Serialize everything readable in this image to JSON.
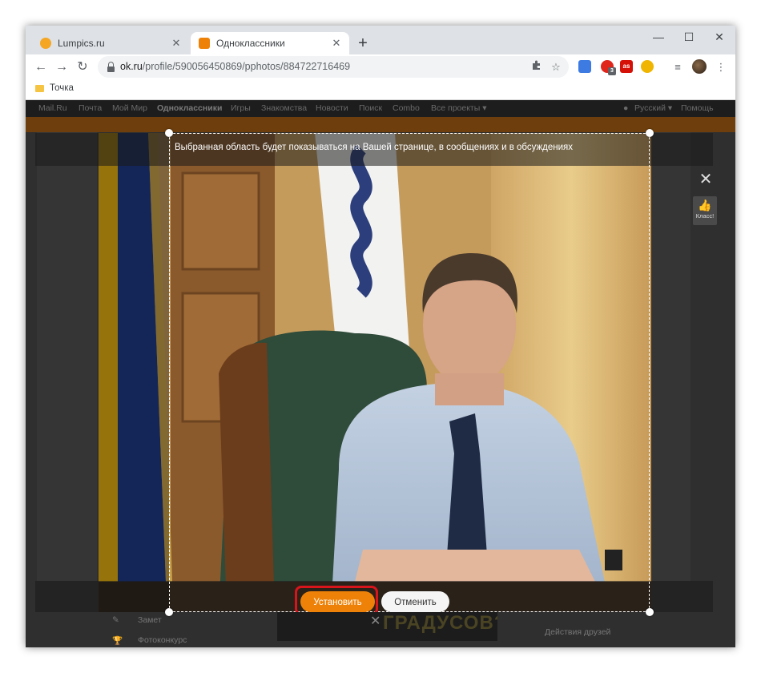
{
  "browser": {
    "tabs": [
      {
        "title": "Lumpics.ru",
        "favicon_color": "#f5a623",
        "active": false
      },
      {
        "title": "Одноклассники",
        "favicon_color": "#ee8208",
        "active": true
      }
    ],
    "new_tab_glyph": "+",
    "close_tab_glyph": "✕",
    "window_controls": {
      "minimize": "—",
      "maximize": "☐",
      "close": "✕"
    },
    "nav": {
      "back": "←",
      "forward": "→",
      "reload": "↻"
    },
    "address": {
      "host": "ok.ru",
      "path": "/profile/590056450869/pphotos/884722716469"
    },
    "extensions": [
      {
        "name": "vpn-extension-icon",
        "color": "#3d7be2",
        "label": ""
      },
      {
        "name": "red-extension-icon",
        "color": "#e0251b",
        "label": ""
      },
      {
        "name": "lastfm-extension-icon",
        "color": "#d51007",
        "label": "as"
      },
      {
        "name": "shield-extension-icon",
        "color": "#f0b500",
        "label": ""
      }
    ],
    "extension_badge": "3",
    "bookmarks": [
      {
        "label": "Точка"
      }
    ],
    "menu_glyph": "⋮"
  },
  "ok_nav": {
    "items": [
      "Mail.Ru",
      "Почта",
      "Мой Мир",
      "Одноклассники",
      "Игры",
      "Знакомства",
      "Новости",
      "Поиск",
      "Combo",
      "Все проекты ▾"
    ],
    "language": "Русский ▾",
    "help": "Помощь"
  },
  "editor": {
    "hint": "Выбранная область будет показываться на Вашей странице, в сообщениях и в обсуждениях",
    "close_glyph": "✕",
    "class_label": "Класс!",
    "class_glyph": "👍",
    "set_button": "Установить",
    "cancel_button": "Отменить"
  },
  "underlay": {
    "left_item_1": "Замет",
    "left_item_2": "Фотоконкурс",
    "right_item": "Действия друзей",
    "banner_text": "ГРАДУСОВ?",
    "close_glyph": "✕"
  },
  "colors": {
    "ok_orange": "#ee8208",
    "highlight_red": "#d8151b"
  }
}
